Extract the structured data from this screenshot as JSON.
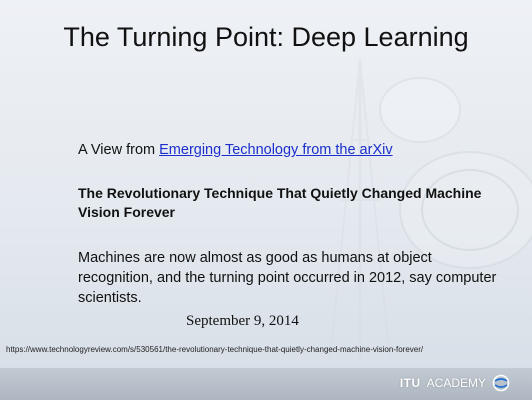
{
  "slide": {
    "title": "The Turning Point: Deep Learning",
    "intro_prefix": "A View from ",
    "intro_link": "Emerging Technology from the arXiv",
    "headline": "The Revolutionary Technique That Quietly Changed Machine Vision Forever",
    "summary": "Machines are now almost as good as humans at object recognition, and the turning point occurred in 2012, say computer scientists.",
    "date": "September 9, 2014",
    "url": "https://www.technologyreview.com/s/530561/the-revolutionary-technique-that-quietly-changed-machine-vision-forever/"
  },
  "footer": {
    "logo_itu": "ITU",
    "logo_academy": "ACADEMY"
  },
  "colors": {
    "link": "#1c2fcc",
    "footer": "#b4bdc7"
  }
}
